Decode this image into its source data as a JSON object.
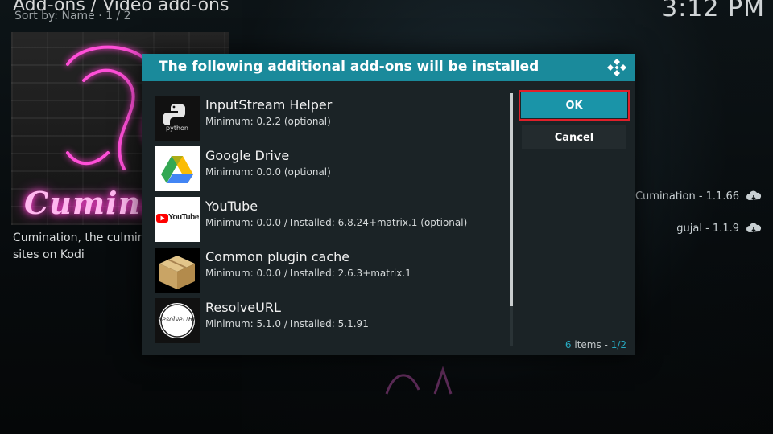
{
  "background": {
    "breadcrumb": "Add-ons / Video add-ons",
    "sort_line": "Sort by: Name  ·  1 / 2",
    "clock": "3:12 PM",
    "thumbnail_title": "Cumina",
    "description": "Cumination, the culmina sites on Kodi",
    "list": [
      {
        "label": "Cumination - 1.1.66",
        "icon": "cloud-download-icon"
      },
      {
        "label": "gujal - 1.1.9",
        "icon": "cloud-download-icon"
      }
    ]
  },
  "dialog": {
    "title": "The following additional add-ons will be installed",
    "logo": "kodi-logo",
    "items": [
      {
        "name": "InputStream Helper",
        "detail": "Minimum: 0.2.2 (optional)",
        "icon": "python-icon",
        "icon_text": "python"
      },
      {
        "name": "Google Drive",
        "detail": "Minimum: 0.0.0 (optional)",
        "icon": "google-drive-icon"
      },
      {
        "name": "YouTube",
        "detail": "Minimum: 0.0.0 / Installed: 6.8.24+matrix.1 (optional)",
        "icon": "youtube-icon",
        "icon_text": "YouTube"
      },
      {
        "name": "Common plugin cache",
        "detail": "Minimum: 0.0.0 / Installed: 2.6.3+matrix.1",
        "icon": "box-icon"
      },
      {
        "name": "ResolveURL",
        "detail": "Minimum: 5.1.0 / Installed: 5.1.91",
        "icon": "resolveurl-icon",
        "icon_text": "ResolveURL"
      }
    ],
    "ok_label": "OK",
    "cancel_label": "Cancel",
    "counter": {
      "count": "6",
      "label": " items - ",
      "page": "1/2"
    }
  },
  "colors": {
    "accent": "#1a8a9b",
    "ok_button": "#1a94a8",
    "focus_outline": "#e0202a",
    "neon_pink": "#ff3fd0"
  }
}
